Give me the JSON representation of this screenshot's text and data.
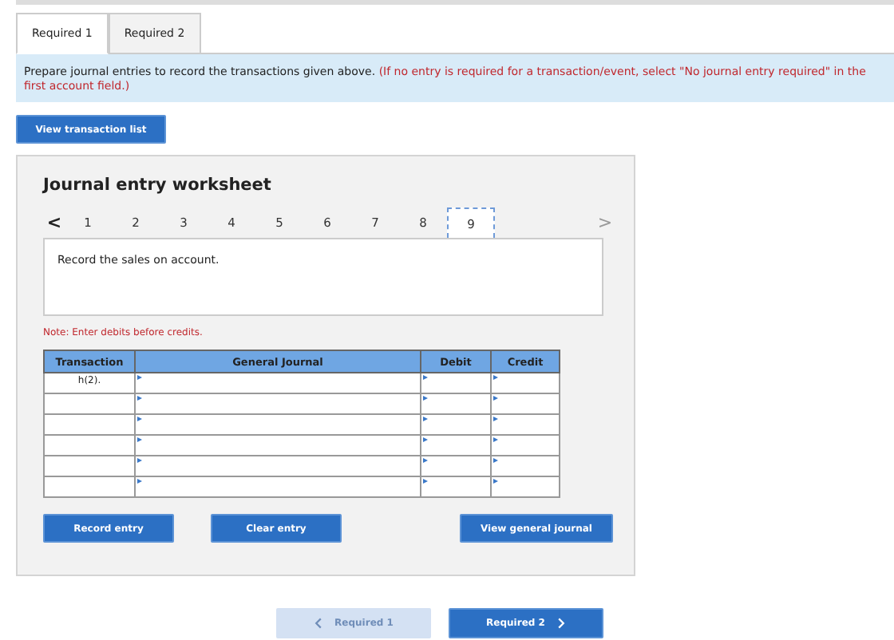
{
  "tabs": [
    {
      "label": "Required 1",
      "selected": true
    },
    {
      "label": "Required 2",
      "selected": false
    }
  ],
  "instructions": {
    "text": "Prepare journal entries to record the transactions given above.",
    "note": "(If no entry is required for a transaction/event, select \"No journal entry required\" in the first account field.)"
  },
  "view_transaction_button": "View transaction list",
  "worksheet": {
    "title": "Journal entry worksheet",
    "prev": "<",
    "next": ">",
    "pages": [
      {
        "label": "1",
        "selected": false
      },
      {
        "label": "2",
        "selected": false
      },
      {
        "label": "3",
        "selected": false
      },
      {
        "label": "4",
        "selected": false
      },
      {
        "label": "5",
        "selected": false
      },
      {
        "label": "6",
        "selected": false
      },
      {
        "label": "7",
        "selected": false
      },
      {
        "label": "8",
        "selected": false
      },
      {
        "label": "9",
        "selected": true
      }
    ],
    "description": "Record the sales on account.",
    "note": "Note: Enter debits before credits.",
    "table": {
      "columns": [
        "Transaction",
        "General Journal",
        "Debit",
        "Credit"
      ],
      "rows": [
        {
          "transaction": "h(2)."
        },
        {},
        {},
        {},
        {},
        {}
      ]
    },
    "buttons": [
      "Record entry",
      "Clear entry",
      "View general journal"
    ]
  },
  "nav": {
    "prev": {
      "label": "Required 1",
      "disabled": true
    },
    "next": {
      "label": "Required 2",
      "disabled": false
    }
  }
}
